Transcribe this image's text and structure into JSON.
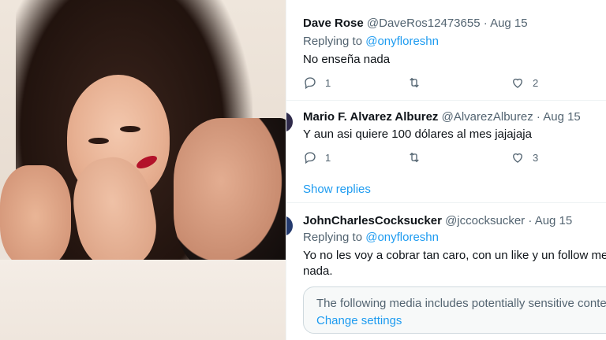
{
  "thread": {
    "tweets": [
      {
        "name": "Dave Rose",
        "handle": "@DaveRos12473655",
        "separator": "·",
        "date": "Aug 15",
        "replying_label": "Replying to",
        "replying_to": "@onyfloreshn",
        "text": "No enseña nada",
        "replies": "1",
        "likes": "2"
      },
      {
        "name": "Mario F. Alvarez Alburez",
        "handle": "@AlvarezAlburez",
        "separator": "·",
        "date": "Aug 15",
        "text": "Y aun asi quiere 100 dólares al mes jajajaja",
        "replies": "1",
        "likes": "3",
        "show_replies": "Show replies"
      },
      {
        "name": "JohnCharlesCocksucker",
        "handle": "@jccocksucker",
        "separator": "·",
        "date": "Aug 15",
        "replying_label": "Replying to",
        "replying_to": "@onyfloreshn",
        "text_line1": "Yo no les voy a cobrar tan caro, con un like y un follow me c",
        "text_line2": "nada.",
        "notice_text": "The following media includes potentially sensitive conte",
        "notice_link": "Change settings"
      }
    ]
  },
  "icons": {
    "reply": "reply-icon",
    "retweet": "retweet-icon",
    "like": "heart-icon"
  },
  "colors": {
    "link": "#1d9bf0",
    "secondary_text": "#536471",
    "primary_text": "#0f1419"
  }
}
